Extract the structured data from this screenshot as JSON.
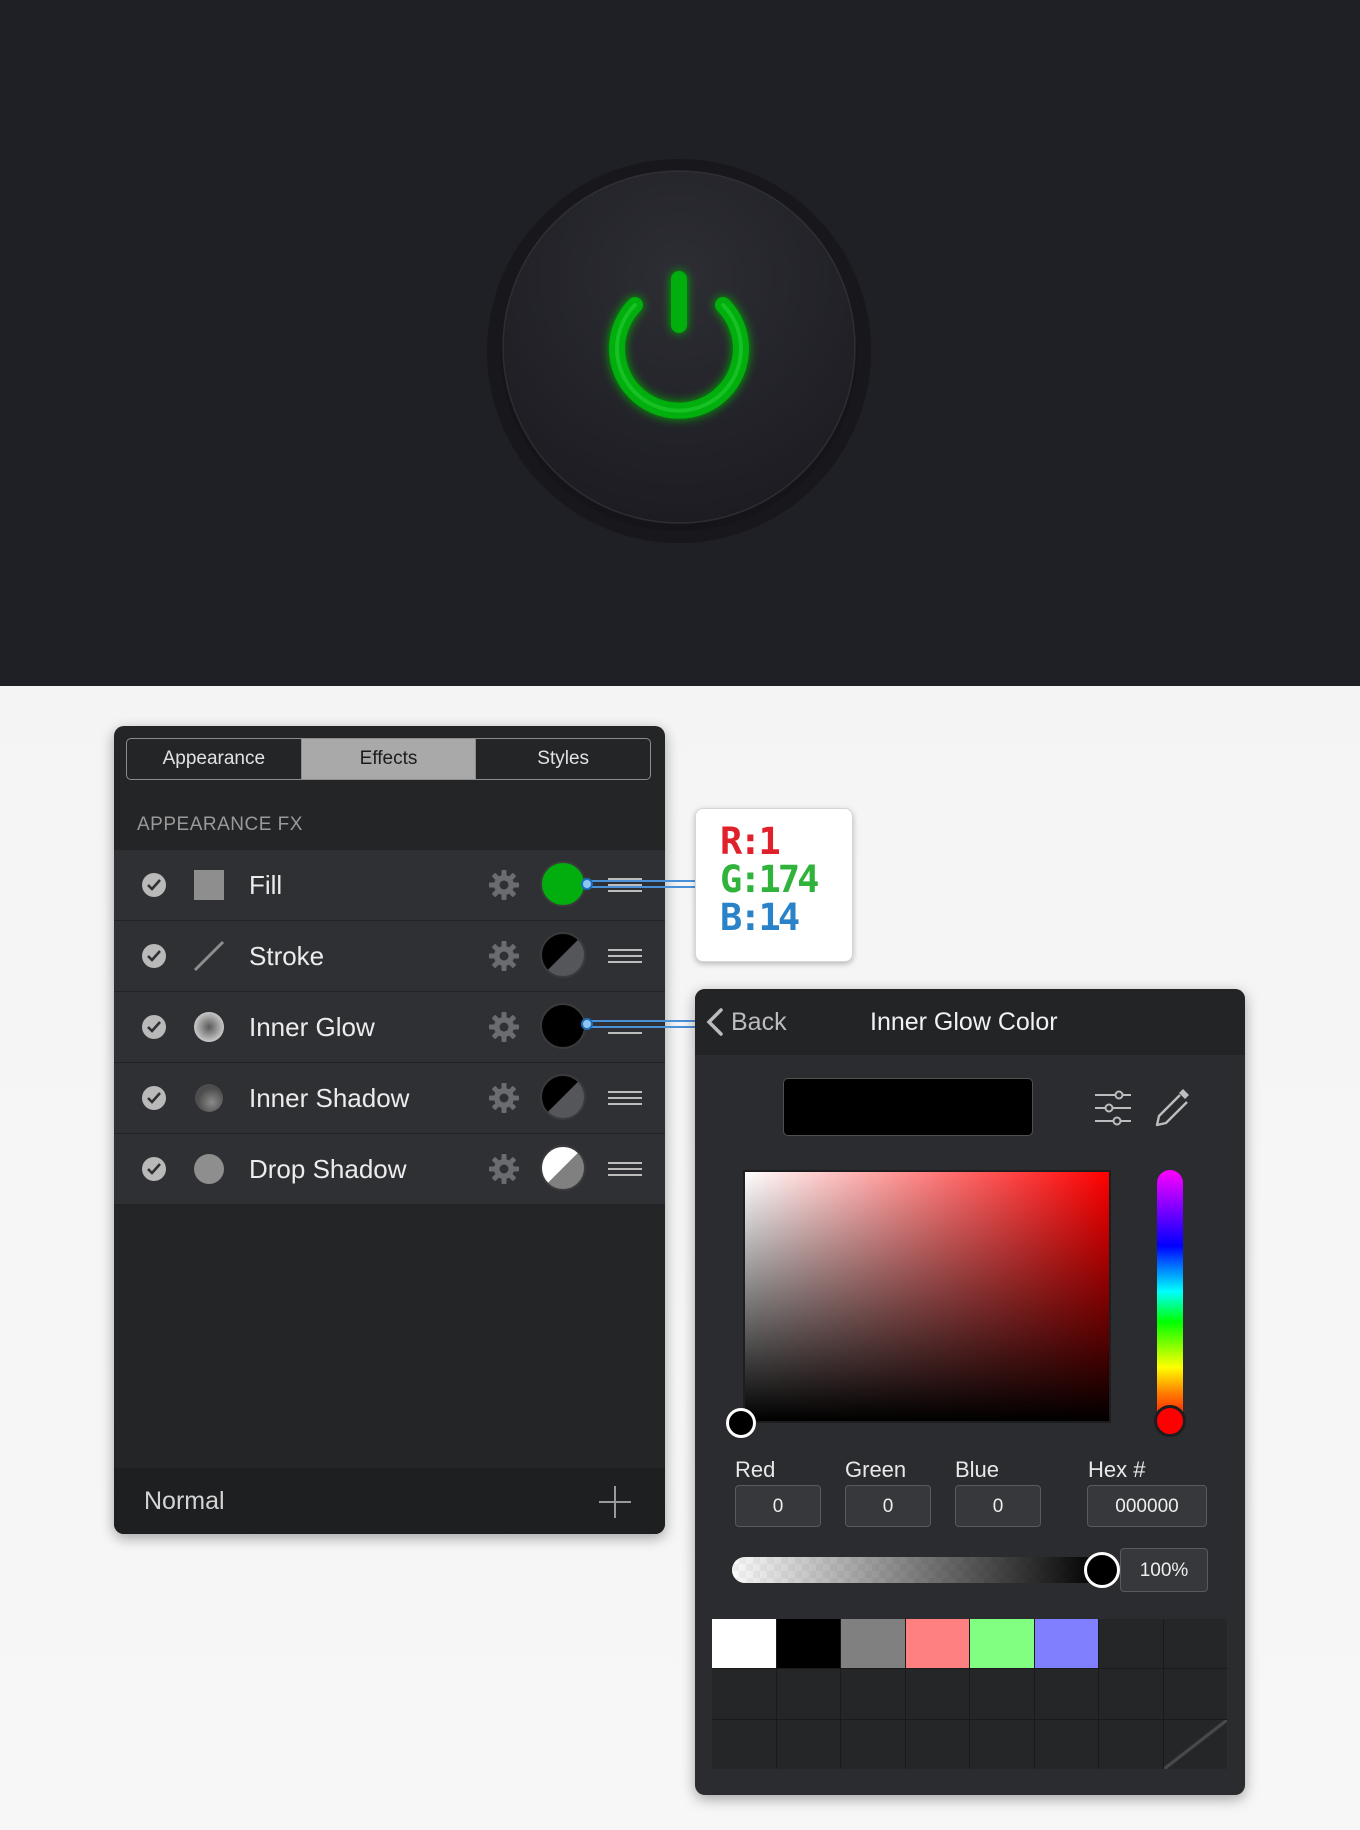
{
  "canvas": {
    "background": "#1f1f26",
    "power_icon_color": "#01ae0e"
  },
  "appearance_panel": {
    "tabs": [
      {
        "label": "Appearance",
        "active": false
      },
      {
        "label": "Effects",
        "active": true
      },
      {
        "label": "Styles",
        "active": false
      }
    ],
    "section_title": "APPEARANCE FX",
    "effects": [
      {
        "label": "Fill",
        "enabled": true,
        "icon": "square-fill-icon",
        "swatch": "#01ae0e"
      },
      {
        "label": "Stroke",
        "enabled": true,
        "icon": "line-stroke-icon",
        "swatch": "black-gray-split"
      },
      {
        "label": "Inner Glow",
        "enabled": true,
        "icon": "inner-glow-icon",
        "swatch": "#000000"
      },
      {
        "label": "Inner Shadow",
        "enabled": true,
        "icon": "inner-shadow-icon",
        "swatch": "black-gray-split"
      },
      {
        "label": "Drop Shadow",
        "enabled": true,
        "icon": "drop-shadow-icon",
        "swatch": "white-gray-split"
      }
    ],
    "footer": {
      "blend_mode": "Normal"
    }
  },
  "rgb_callout": {
    "r": "R:1",
    "g": "G:174",
    "b": "B:14",
    "r_color": "#e0212c",
    "g_color": "#2fb33a",
    "b_color": "#2a83c9"
  },
  "color_picker": {
    "back_label": "Back",
    "title": "Inner Glow Color",
    "preview_color": "#000000",
    "hue_color": "#ff0000",
    "fields": [
      {
        "label": "Red",
        "value": "0"
      },
      {
        "label": "Green",
        "value": "0"
      },
      {
        "label": "Blue",
        "value": "0"
      },
      {
        "label": "Hex #",
        "value": "000000"
      }
    ],
    "opacity": "100%",
    "swatches": [
      "#ffffff",
      "#000000",
      "#808080",
      "#ff8080",
      "#80ff80",
      "#8080ff"
    ]
  }
}
